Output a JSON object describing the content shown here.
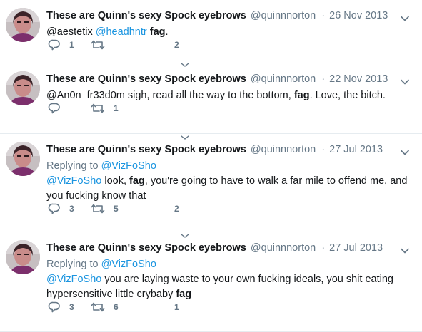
{
  "tweets": [
    {
      "fullname": "These are Quinn's sexy Spock eyebrows",
      "screenname": "@quinnnorton",
      "separator": "·",
      "timestamp": "26 Nov 2013",
      "text_parts": [
        {
          "text": "@aestetix ",
          "style": "plain"
        },
        {
          "text": "@headhntr",
          "style": "mention"
        },
        {
          "text": " ",
          "style": "plain"
        },
        {
          "text": "fag",
          "style": "bold"
        },
        {
          "text": ".",
          "style": "plain"
        }
      ],
      "replies": "1",
      "retweets": "",
      "likes": "2"
    },
    {
      "fullname": "These are Quinn's sexy Spock eyebrows",
      "screenname": "@quinnnorton",
      "separator": "·",
      "timestamp": "22 Nov 2013",
      "text_parts": [
        {
          "text": "@An0n_fr33d0m sigh, read all the way to the bottom, ",
          "style": "plain"
        },
        {
          "text": "fag",
          "style": "bold"
        },
        {
          "text": ". Love, the bitch.",
          "style": "plain"
        }
      ],
      "replies": "",
      "retweets": "1",
      "likes": ""
    },
    {
      "fullname": "These are Quinn's sexy Spock eyebrows",
      "screenname": "@quinnnorton",
      "separator": "·",
      "timestamp": "27 Jul 2013",
      "replying_prefix": "Replying to ",
      "replying_to": "@VizFoSho",
      "text_parts": [
        {
          "text": "@VizFoSho",
          "style": "mention"
        },
        {
          "text": " look, ",
          "style": "plain"
        },
        {
          "text": "fag",
          "style": "bold"
        },
        {
          "text": ", you're going to have to walk a far mile to offend me, and you fucking know that",
          "style": "plain"
        }
      ],
      "replies": "3",
      "retweets": "5",
      "likes": "2"
    },
    {
      "fullname": "These are Quinn's sexy Spock eyebrows",
      "screenname": "@quinnnorton",
      "separator": "·",
      "timestamp": "27 Jul 2013",
      "replying_prefix": "Replying to ",
      "replying_to": "@VizFoSho",
      "text_parts": [
        {
          "text": "@VizFoSho",
          "style": "mention"
        },
        {
          "text": " you are laying waste to your own fucking ideals, you shit eating hypersensitive little crybaby ",
          "style": "plain"
        },
        {
          "text": "fag",
          "style": "bold"
        }
      ],
      "replies": "3",
      "retweets": "6",
      "likes": "1"
    }
  ],
  "icons": {
    "reply": "reply-icon",
    "retweet": "retweet-icon",
    "like": "like-icon",
    "caret": "chevron-down-icon",
    "thread": "thread-caret-icon"
  },
  "colors": {
    "text": "#14171a",
    "secondary": "#657786",
    "link": "#1b95e0",
    "divider": "#e6ecf0",
    "background": "#ffffff"
  }
}
